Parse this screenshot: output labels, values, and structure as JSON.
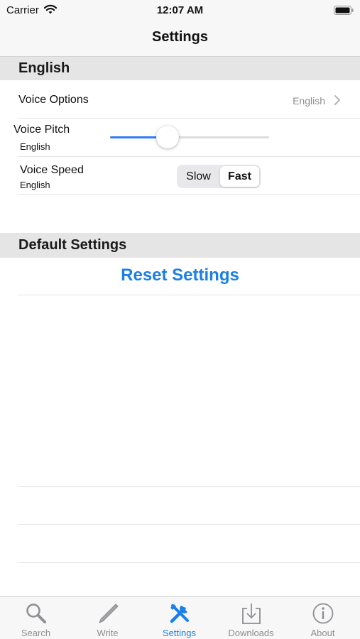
{
  "status_bar": {
    "carrier": "Carrier",
    "time": "12:07 AM"
  },
  "nav": {
    "title": "Settings"
  },
  "sections": {
    "english": "English",
    "default": "Default Settings"
  },
  "voice_options": {
    "label": "Voice Options",
    "value": "English"
  },
  "voice_pitch": {
    "label": "Voice Pitch",
    "sub": "English",
    "value_fraction": 0.36
  },
  "voice_speed": {
    "label": "Voice Speed",
    "sub": "English",
    "options": [
      "Slow",
      "Fast"
    ],
    "selected": "Fast"
  },
  "reset": {
    "label": "Reset Settings"
  },
  "tabs": [
    {
      "label": "Search",
      "icon": "search-icon",
      "active": false
    },
    {
      "label": "Write",
      "icon": "pencil-icon",
      "active": false
    },
    {
      "label": "Settings",
      "icon": "tools-icon",
      "active": true
    },
    {
      "label": "Downloads",
      "icon": "download-icon",
      "active": false
    },
    {
      "label": "About",
      "icon": "info-icon",
      "active": false
    }
  ],
  "colors": {
    "accent": "#1a7fe6",
    "slider_fill": "#2f7cf6",
    "section_bg": "#e5e5e5",
    "inactive_tab": "#8e8e93"
  }
}
